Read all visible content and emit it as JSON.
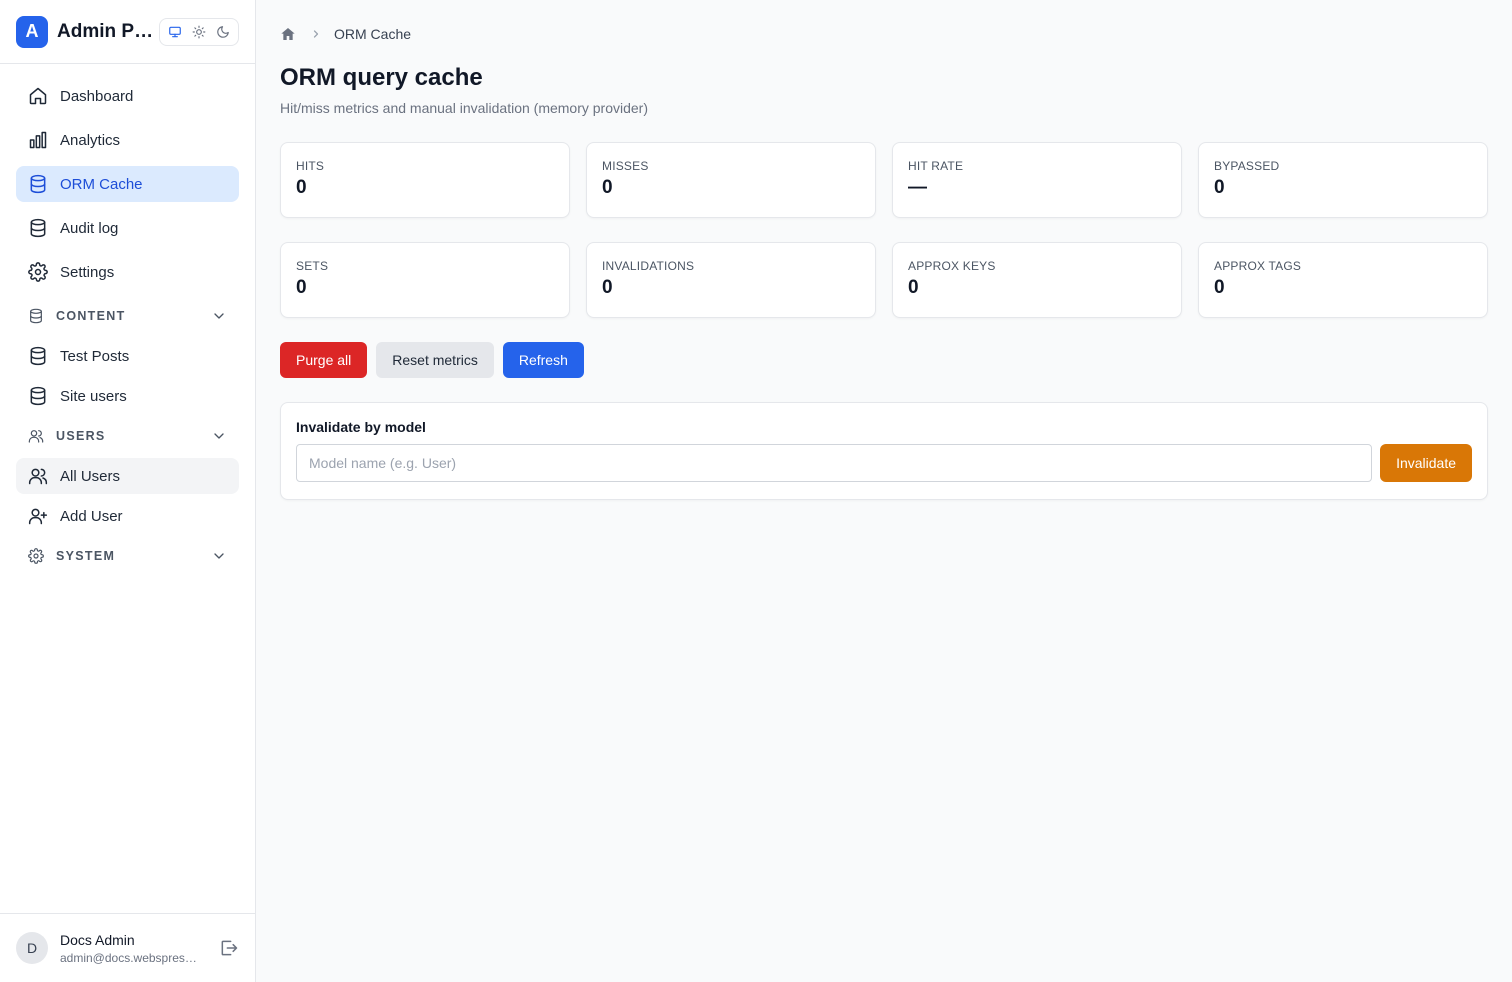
{
  "app": {
    "logo_letter": "A",
    "title": "Admin Panel"
  },
  "theme_switch": {
    "options": [
      "monitor-icon",
      "sun-icon",
      "moon-icon"
    ],
    "active": "monitor-icon"
  },
  "sidebar": {
    "items": [
      {
        "label": "Dashboard",
        "icon": "home-icon"
      },
      {
        "label": "Analytics",
        "icon": "bar-chart-icon"
      },
      {
        "label": "ORM Cache",
        "icon": "database-icon",
        "active": true
      },
      {
        "label": "Audit log",
        "icon": "database-icon"
      },
      {
        "label": "Settings",
        "icon": "gear-icon"
      }
    ],
    "sections": {
      "content": {
        "label": "CONTENT",
        "items": [
          {
            "label": "Test Posts"
          },
          {
            "label": "Site users"
          }
        ]
      },
      "users": {
        "label": "USERS",
        "items": [
          {
            "label": "All Users"
          },
          {
            "label": "Add User"
          }
        ]
      },
      "system": {
        "label": "SYSTEM"
      }
    }
  },
  "user": {
    "avatar_letter": "D",
    "name": "Docs Admin",
    "email": "admin@docs.webspresso.dev"
  },
  "breadcrumb": {
    "current": "ORM Cache"
  },
  "page": {
    "title": "ORM query cache",
    "subtitle": "Hit/miss metrics and manual invalidation (memory provider)"
  },
  "stats": [
    {
      "label": "HITS",
      "value": "0"
    },
    {
      "label": "MISSES",
      "value": "0"
    },
    {
      "label": "HIT RATE",
      "value": "—"
    },
    {
      "label": "BYPASSED",
      "value": "0"
    },
    {
      "label": "SETS",
      "value": "0"
    },
    {
      "label": "INVALIDATIONS",
      "value": "0"
    },
    {
      "label": "APPROX KEYS",
      "value": "0"
    },
    {
      "label": "APPROX TAGS",
      "value": "0"
    }
  ],
  "actions": {
    "purge": "Purge all",
    "reset": "Reset metrics",
    "refresh": "Refresh"
  },
  "invalidate": {
    "title": "Invalidate by model",
    "placeholder": "Model name (e.g. User)",
    "value": "",
    "button": "Invalidate"
  },
  "colors": {
    "accent": "#2563eb",
    "danger": "#dc2626",
    "warning": "#d97706",
    "active_bg": "#dbeafe"
  }
}
